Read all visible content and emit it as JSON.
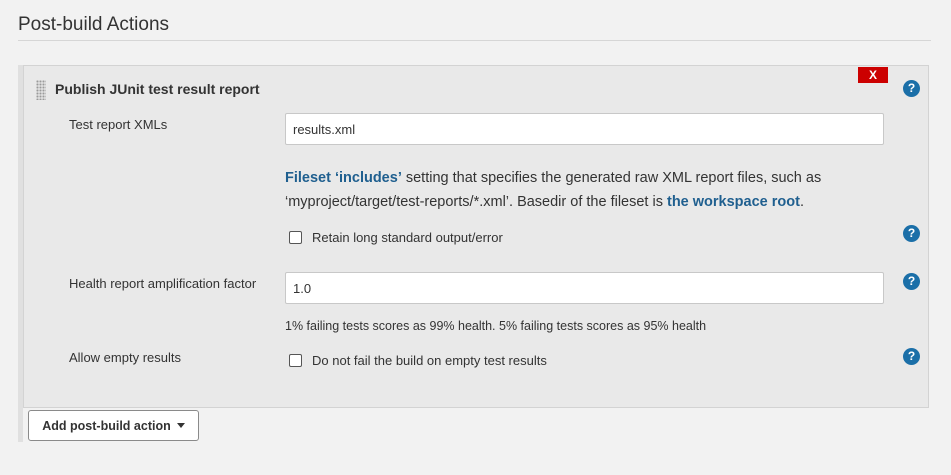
{
  "section": {
    "title": "Post-build Actions"
  },
  "junit": {
    "title": "Publish JUnit test result report",
    "delete_label": "X",
    "help_label": "?",
    "test_report_xmls": {
      "label": "Test report XMLs",
      "value": "results.xml",
      "description": {
        "link1": "Fileset ‘includes’",
        "text1": " setting that specifies the generated raw XML report files, such as ‘myproject/target/test-reports/*.xml’. Basedir of the fileset is ",
        "link2": "the workspace root",
        "text2": "."
      }
    },
    "retain_output": {
      "label": "Retain long standard output/error",
      "checked": false
    },
    "health_factor": {
      "label": "Health report amplification factor",
      "value": "1.0",
      "hint": "1% failing tests scores as 99% health. 5% failing tests scores as 95% health"
    },
    "allow_empty": {
      "label": "Allow empty results",
      "checkbox_label": "Do not fail the build on empty test results",
      "checked": false
    }
  },
  "add_action": {
    "label": "Add post-build action"
  },
  "colors": {
    "accent_link": "#1f5f8f",
    "help_icon": "#1b6fa8",
    "delete": "#cc0000"
  }
}
